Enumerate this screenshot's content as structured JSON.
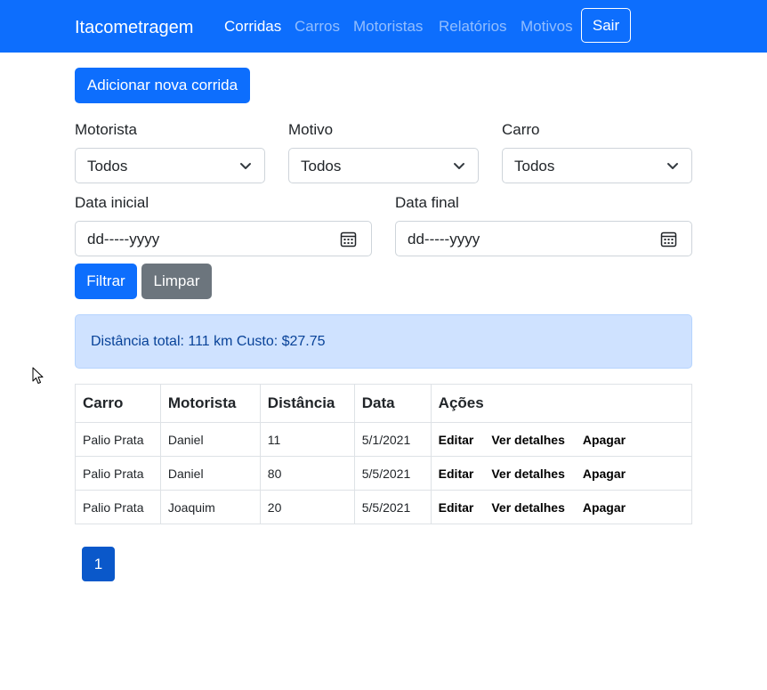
{
  "navbar": {
    "brand": "Itacometragem",
    "links": [
      {
        "label": "Corridas",
        "active": true
      },
      {
        "label": "Carros",
        "active": false
      },
      {
        "label": "Motoristas",
        "active": false
      },
      {
        "label": "Relatórios",
        "active": false
      },
      {
        "label": "Motivos",
        "active": false
      }
    ],
    "logout_label": "Sair",
    "color": "#0d6efd"
  },
  "actions": {
    "add_label": "Adicionar nova corrida"
  },
  "filters": {
    "motorista": {
      "label": "Motorista",
      "value": "Todos"
    },
    "motivo": {
      "label": "Motivo",
      "value": "Todos"
    },
    "carro": {
      "label": "Carro",
      "value": "Todos"
    },
    "data_inicial": {
      "label": "Data inicial",
      "value": "dd-----yyyy"
    },
    "data_final": {
      "label": "Data final",
      "value": "dd-----yyyy"
    },
    "filter_label": "Filtrar",
    "clear_label": "Limpar"
  },
  "summary": {
    "text": "Distância total: 111 km Custo: $27.75"
  },
  "table": {
    "headers": [
      "Carro",
      "Motorista",
      "Distância",
      "Data",
      "Ações"
    ],
    "rows": [
      {
        "carro": "Palio Prata",
        "motorista": "Daniel",
        "distancia": "11",
        "data": "5/1/2021"
      },
      {
        "carro": "Palio Prata",
        "motorista": "Daniel",
        "distancia": "80",
        "data": "5/5/2021"
      },
      {
        "carro": "Palio Prata",
        "motorista": "Joaquim",
        "distancia": "20",
        "data": "5/5/2021"
      }
    ],
    "actions": [
      "Editar",
      "Ver detalhes",
      "Apagar"
    ]
  },
  "pagination": {
    "current_page": "1"
  },
  "icons": {
    "select": "chevron-down-icon",
    "date": "calendar-icon",
    "pointer": "mouse-cursor-icon"
  }
}
